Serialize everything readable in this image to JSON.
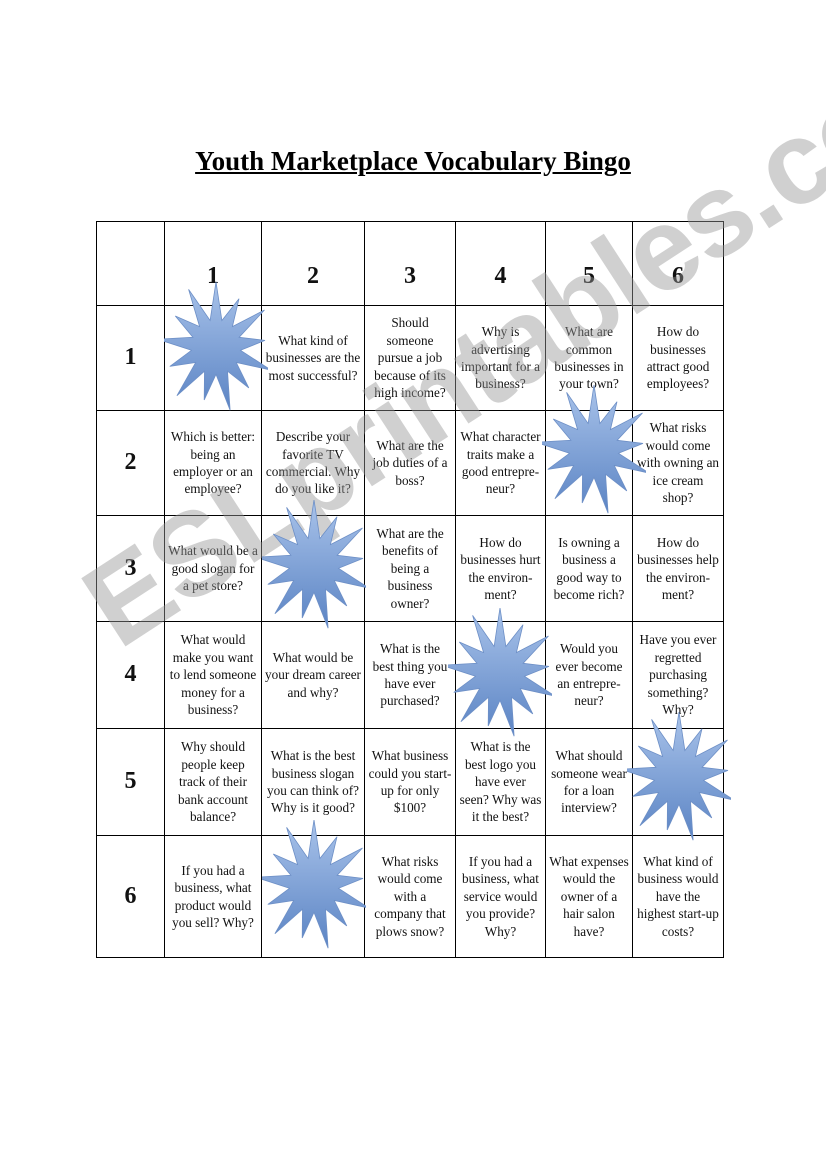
{
  "title": "Youth Marketplace Vocabulary Bingo",
  "watermark": "ESLprintables.com",
  "column_headers": [
    "1",
    "2",
    "3",
    "4",
    "5",
    "6"
  ],
  "rows": [
    {
      "label": "1",
      "cells": [
        "",
        "What kind of businesses are the most successful?",
        "Should someone pursue a job because of its high income?",
        "Why is advertising important for a business?",
        "What are common businesses in your town?",
        "How do businesses attract good employees?"
      ]
    },
    {
      "label": "2",
      "cells": [
        "Which is better: being an employer or an employee?",
        "Describe your favorite TV commercial. Why do you like it?",
        "What are the job duties of a boss?",
        "What character traits make a good entrepre-neur?",
        "",
        "What risks would come with owning an ice cream shop?"
      ]
    },
    {
      "label": "3",
      "cells": [
        "What would be a good slogan for a pet store?",
        "",
        "What are the benefits of being a business owner?",
        "How do businesses hurt the environ-ment?",
        "Is owning a business a good way to become rich?",
        "How do businesses help the environ-ment?"
      ]
    },
    {
      "label": "4",
      "cells": [
        "What would make you want to lend someone money for a business?",
        "What would be your dream career and why?",
        "What is the best thing you have ever purchased?",
        "",
        "Would you ever become an entrepre-neur?",
        "Have you ever regretted purchasing something? Why?"
      ]
    },
    {
      "label": "5",
      "cells": [
        "Why should people keep track of their bank account balance?",
        "What is the best business slogan you can think of? Why is it good?",
        "What business could you start-up for only $100?",
        "What is the best logo you have ever seen? Why was it the best?",
        "What should someone wear for a loan interview?",
        ""
      ]
    },
    {
      "label": "6",
      "cells": [
        "If you had a business, what product would you sell? Why?",
        "",
        "What risks would come with a company that plows snow?",
        "If you had a business, what service would you provide? Why?",
        "What expenses would the owner of a hair salon have?",
        "What kind of business would have the highest start-up costs?"
      ]
    }
  ],
  "starburst_color": "#5b84c4"
}
